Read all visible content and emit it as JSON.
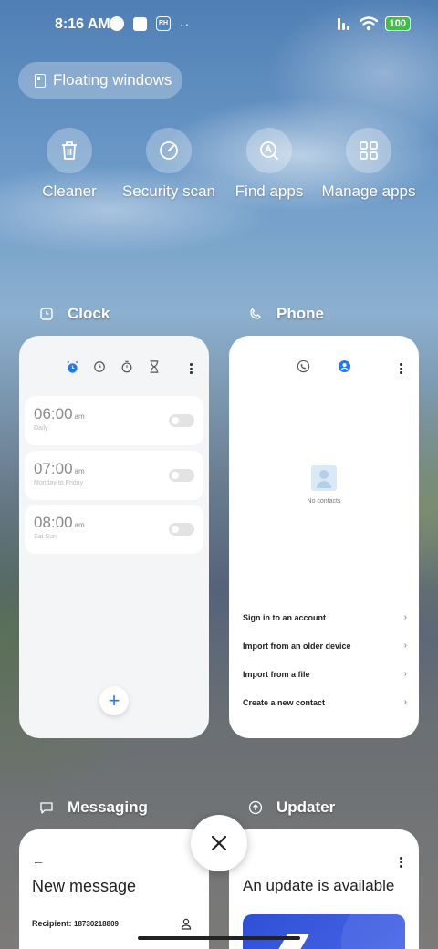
{
  "status_bar": {
    "time": "8:16 AM",
    "battery": "100",
    "hex_label": "RH",
    "dots": "··"
  },
  "floating_windows": {
    "label": "Floating windows"
  },
  "quick_actions": [
    {
      "label": "Cleaner",
      "icon": "trash-icon"
    },
    {
      "label": "Security scan",
      "icon": "security-gauge-icon"
    },
    {
      "label": "Find apps",
      "icon": "find-apps-icon"
    },
    {
      "label": "Manage apps",
      "icon": "grid-icon"
    }
  ],
  "apps": {
    "clock": {
      "name": "Clock",
      "alarms": [
        {
          "time": "06:00",
          "ampm": "am",
          "repeat": "Daily"
        },
        {
          "time": "07:00",
          "ampm": "am",
          "repeat": "Monday to Friday"
        },
        {
          "time": "08:00",
          "ampm": "am",
          "repeat": "Sat Sun"
        }
      ],
      "fab": "+"
    },
    "phone": {
      "name": "Phone",
      "empty_text": "No contacts",
      "options": [
        "Sign in to an account",
        "Import from an older device",
        "Import from a file",
        "Create a new contact"
      ],
      "chevron": "›"
    },
    "messaging": {
      "name": "Messaging",
      "title": "New message",
      "back": "←",
      "recipient_label": "Recipient:",
      "recipient_value": "18730218809"
    },
    "updater": {
      "name": "Updater",
      "title": "An update is available"
    }
  },
  "close_button": {
    "label": "×"
  },
  "colors": {
    "accent": "#1e7bff",
    "battery": "#3cc04a",
    "card": "#f4f5f6"
  }
}
